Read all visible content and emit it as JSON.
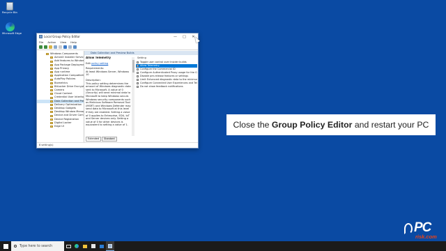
{
  "desktop": {
    "icons": [
      {
        "label": "Recycle Bin",
        "icon": "recycle-bin-icon"
      },
      {
        "label": "Microsoft Edge",
        "icon": "edge-icon"
      }
    ]
  },
  "window": {
    "title": "Local Group Policy Editor",
    "menu": [
      "File",
      "Action",
      "View",
      "Help"
    ],
    "tree": [
      "Windows Components",
      "ActiveX Installer Service",
      "Add features to Windows",
      "App Package Deployment",
      "App Privacy",
      "App runtime",
      "Application Compatibility",
      "AutoPlay Policies",
      "Biometrics",
      "BitLocker Drive Encryption",
      "Camera",
      "Cloud Content",
      "Credential User Interface",
      "Data Collection and Preview Builds",
      "Delivery Optimization",
      "Desktop Gadgets",
      "Desktop Window Manager",
      "Device and Driver Compatibility",
      "Device Registration",
      "Digital Locker",
      "Edge UI"
    ],
    "selected_tree_index": 13,
    "header": "Data Collection and Preview Builds",
    "description": {
      "title": "Allow Telemetry",
      "edit_prefix": "Edit",
      "edit_link": "policy setting",
      "requirements_label": "Requirements:",
      "requirements": "At least Windows Server, Windows 10",
      "description_label": "Description:",
      "body": "This policy setting determines the amount of Windows diagnostic data sent to Microsoft. A value of 0 (Security) will send minimal data to Microsoft to keep Windows secure. Windows security components such as Malicious Software Removal Tool (MSRT) and Windows Defender may send data to Microsoft at this level if they are enabled. Setting a value of 0 applies to Enterprise, EDU, IoT and Server devices only. Setting a value of 0 for other devices is equivalent to setting a value of 1."
    },
    "settings_header": "Setting",
    "settings": [
      "Toggle user control over Insider builds",
      "Allow Telemetry",
      "Configure the Commercial ID",
      "Configure Authenticated Proxy usage for the Connected User Experience and Telemetry service",
      "Disable pre-release features or settings",
      "Limit Enhanced diagnostic data to the minimum required by Windows Analytics",
      "Configure Connected User Experiences and Telemetry",
      "Do not show feedback notifications"
    ],
    "selected_setting_index": 1,
    "tabs": [
      "Extended",
      "Standard"
    ],
    "status": "8 setting(s)"
  },
  "instruction": {
    "prefix": "Close the ",
    "bold": "Group Policy Editor",
    "suffix": " and restart your PC"
  },
  "watermark": {
    "main": "PC",
    "sub": "risk.com"
  },
  "taskbar": {
    "search_placeholder": "Type here to search",
    "pinned": [
      "task-view-icon",
      "edge-icon",
      "file-explorer-icon",
      "store-icon",
      "mail-icon",
      "group-policy-icon"
    ]
  },
  "colors": {
    "desktop": "#0a4aa3",
    "selection": "#0078d7",
    "watermark_accent": "#e8431a"
  }
}
